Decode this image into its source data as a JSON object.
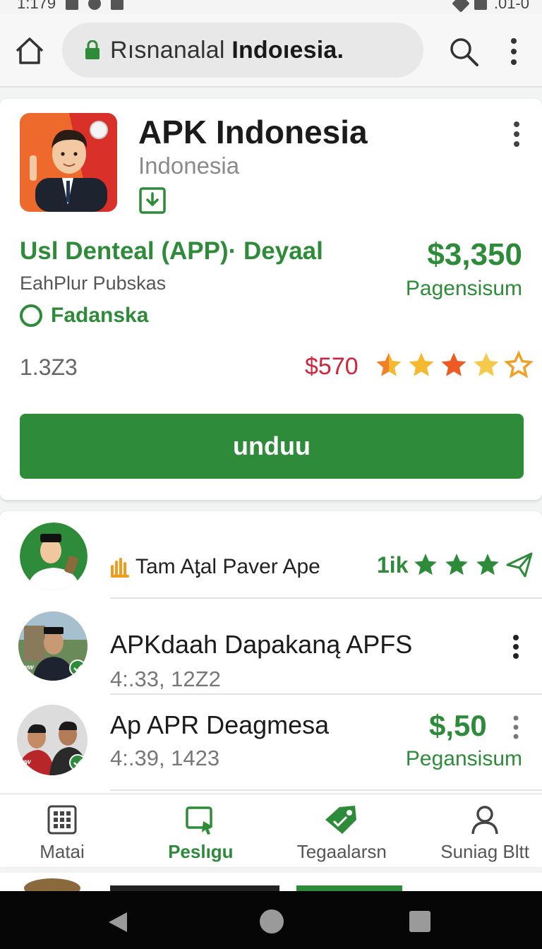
{
  "status_bar": {
    "time": "1:179",
    "right_text": ".01-0"
  },
  "browser": {
    "url_prefix": "Rısnanalal",
    "url_domain": "Indoıesia."
  },
  "app_card": {
    "title": "APK Indonesia",
    "subtitle": "Indonesia",
    "promo_title": "Usl Denteal (APP)· Deyaal",
    "publisher": "EahPlur Pubskas",
    "tag": "Fadanska",
    "price": "$3,350",
    "price_caption": "Pagensisum",
    "downloads": "1.3Z3",
    "old_price": "$570",
    "rating": 4,
    "download_button": "unduu"
  },
  "list": [
    {
      "title": "Tam Aƫal Paver Ape",
      "count": "1ik"
    },
    {
      "title": "APKdaah Dapakaną APFS",
      "meta": "4:.33, 12Z2"
    },
    {
      "title": "Ap APR Deagmesa",
      "meta": "4:.39, 1423",
      "price": "$,50",
      "price_caption": "Pegansisum"
    }
  ],
  "bottom_nav": [
    {
      "label": "Matai",
      "icon": "grid-icon"
    },
    {
      "label": "Peslıgu",
      "icon": "screen-play-icon",
      "active": true
    },
    {
      "label": "Tegaalarsn",
      "icon": "tag-icon"
    },
    {
      "label": "Suniag Bltt",
      "icon": "person-icon"
    }
  ],
  "colors": {
    "accent": "#2e8b3a",
    "price_red": "#d0263b",
    "star": "#f5b82e",
    "star_orange": "#ee5a24"
  }
}
